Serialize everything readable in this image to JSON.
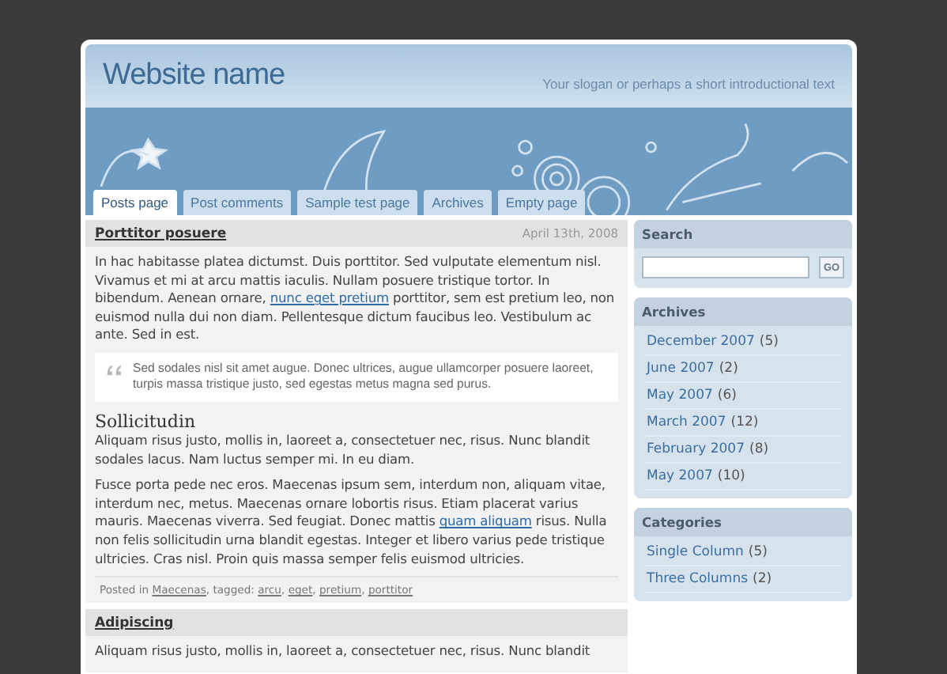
{
  "site": {
    "name": "Website name",
    "slogan": "Your slogan or perhaps a short introductional text"
  },
  "tabs": [
    {
      "label": "Posts page",
      "selected": true
    },
    {
      "label": "Post comments",
      "selected": false
    },
    {
      "label": "Sample test page",
      "selected": false
    },
    {
      "label": "Archives",
      "selected": false
    },
    {
      "label": "Empty page",
      "selected": false
    }
  ],
  "posts": [
    {
      "title": "Porttitor posuere",
      "date": "April 13th, 2008",
      "blocks": [
        {
          "kind": "paragraph",
          "runs": [
            {
              "kind": "text",
              "text": "In hac habitasse platea dictumst. Duis porttitor. Sed vulputate elementum nisl. Vivamus et mi at arcu mattis iaculis. Nullam posuere tristique tortor. In bibendum. Aenean ornare, "
            },
            {
              "kind": "link",
              "text": "nunc eget pretium"
            },
            {
              "kind": "text",
              "text": " porttitor, sem est pretium leo, non euismod nulla dui non diam. Pellentesque dictum faucibus leo. Vestibulum ac ante. Sed in est."
            }
          ]
        },
        {
          "kind": "quote",
          "text": "Sed sodales nisl sit amet augue. Donec ultrices, augue ullamcorper posuere laoreet, turpis massa tristique justo, sed egestas metus magna sed purus."
        },
        {
          "kind": "heading",
          "text": "Sollicitudin"
        },
        {
          "kind": "paragraph",
          "runs": [
            {
              "kind": "text",
              "text": "Aliquam risus justo, mollis in, laoreet a, consectetuer nec, risus. Nunc blandit sodales lacus. Nam luctus semper mi. In eu diam."
            }
          ]
        },
        {
          "kind": "paragraph",
          "runs": [
            {
              "kind": "text",
              "text": "Fusce porta pede nec eros. Maecenas ipsum sem, interdum non, aliquam vitae, interdum nec, metus. Maecenas ornare lobortis risus. Etiam placerat varius mauris. Maecenas viverra. Sed feugiat. Donec mattis "
            },
            {
              "kind": "link",
              "text": "quam aliquam"
            },
            {
              "kind": "text",
              "text": " risus. Nulla non felis sollicitudin urna blandit egestas. Integer et libero varius pede tristique ultricies. Cras nisl. Proin quis massa semper felis euismod ultricies."
            }
          ]
        }
      ],
      "footer": [
        {
          "kind": "text",
          "text": "Posted in "
        },
        {
          "kind": "link",
          "text": "Maecenas"
        },
        {
          "kind": "text",
          "text": ", tagged: "
        },
        {
          "kind": "link",
          "text": "arcu"
        },
        {
          "kind": "text",
          "text": ", "
        },
        {
          "kind": "link",
          "text": "eget"
        },
        {
          "kind": "text",
          "text": ", "
        },
        {
          "kind": "link",
          "text": "pretium"
        },
        {
          "kind": "text",
          "text": ", "
        },
        {
          "kind": "link",
          "text": "porttitor"
        }
      ]
    },
    {
      "title": "Adipiscing",
      "blocks": [
        {
          "kind": "paragraph",
          "runs": [
            {
              "kind": "text",
              "text": "Aliquam risus justo, mollis in, laoreet a, consectetuer nec, risus. Nunc blandit"
            }
          ]
        }
      ]
    }
  ],
  "sidebar": {
    "search": {
      "title": "Search",
      "button": "GO"
    },
    "archives": {
      "title": "Archives",
      "items": [
        {
          "label": "December 2007",
          "count": "(5)"
        },
        {
          "label": "June 2007",
          "count": "(2)"
        },
        {
          "label": "May 2007",
          "count": "(6)"
        },
        {
          "label": "March 2007",
          "count": "(12)"
        },
        {
          "label": "February 2007",
          "count": "(8)"
        },
        {
          "label": "May 2007",
          "count": "(10)"
        }
      ]
    },
    "categories": {
      "title": "Categories",
      "items": [
        {
          "label": "Single Column",
          "count": "(5)"
        },
        {
          "label": "Three Columns",
          "count": "(2)"
        }
      ]
    }
  }
}
